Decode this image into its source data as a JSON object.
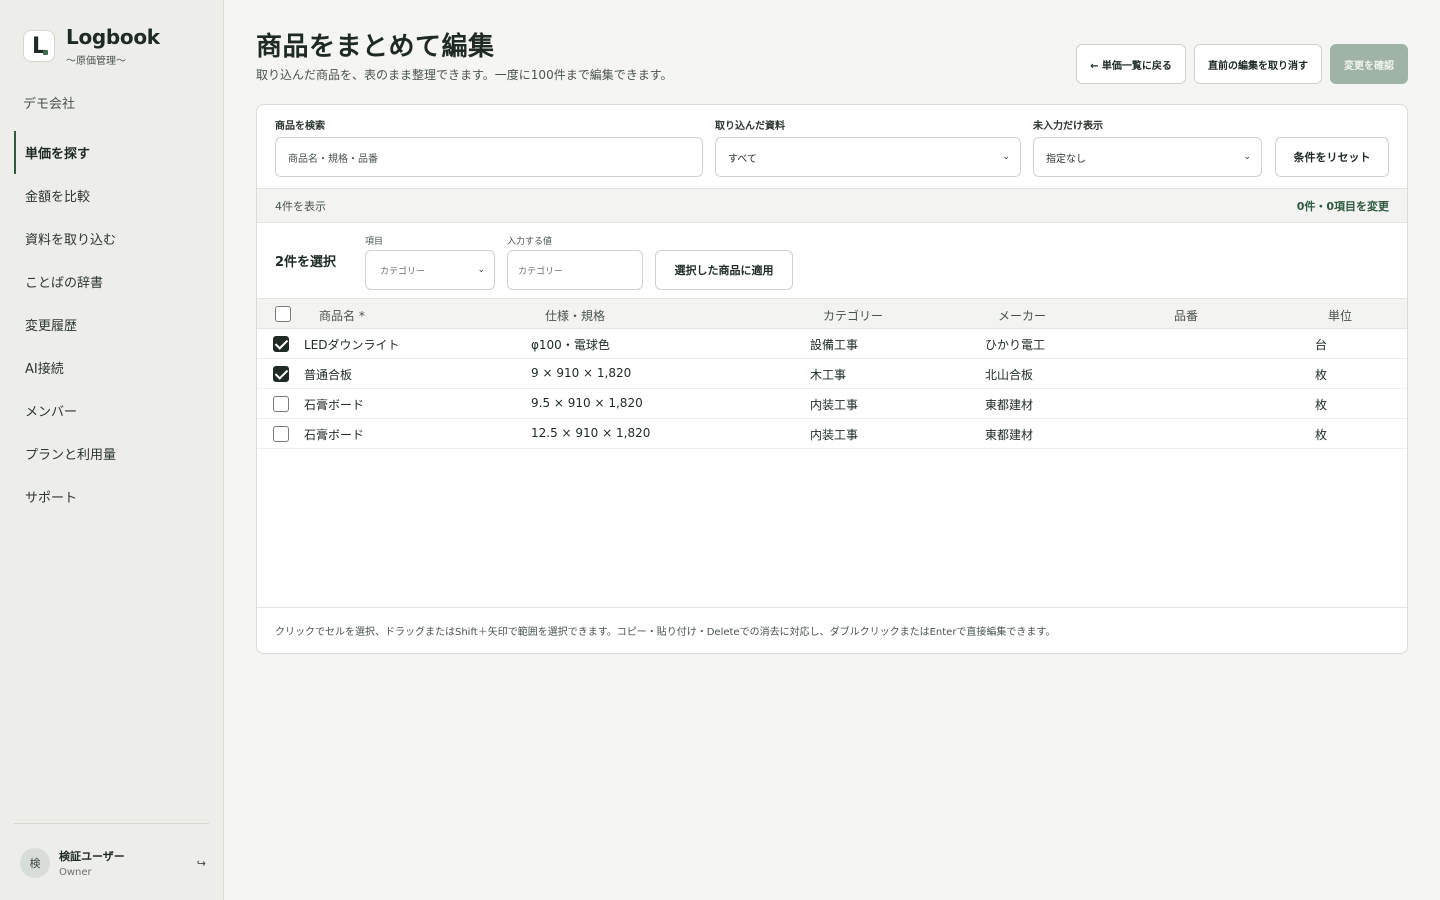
{
  "app": {
    "name": "Logbook",
    "subtitle": "〜原価管理〜",
    "logo_letter": "L",
    "company": "デモ会社"
  },
  "nav": [
    {
      "label": "単価を探す",
      "active": true
    },
    {
      "label": "金額を比較",
      "active": false
    },
    {
      "label": "資料を取り込む",
      "active": false
    },
    {
      "label": "ことばの辞書",
      "active": false
    },
    {
      "label": "変更履歴",
      "active": false
    },
    {
      "label": "AI接続",
      "active": false
    },
    {
      "label": "メンバー",
      "active": false
    },
    {
      "label": "プランと利用量",
      "active": false
    },
    {
      "label": "サポート",
      "active": false
    }
  ],
  "user": {
    "avatar": "検",
    "name": "検証ユーザー",
    "role": "Owner",
    "logout_glyph": "↪"
  },
  "header": {
    "title": "商品をまとめて編集",
    "description": "取り込んだ商品を、表のまま整理できます。一度に100件まで編集できます。",
    "back_button": "← 単価一覧に戻る",
    "undo_button": "直前の編集を取り消す",
    "confirm_button": "変更を確認"
  },
  "filters": {
    "search_label": "商品を検索",
    "search_placeholder": "商品名・規格・品番",
    "source_label": "取り込んだ資料",
    "source_value": "すべて",
    "empty_label": "未入力だけ表示",
    "empty_value": "指定なし",
    "reset_button": "条件をリセット"
  },
  "status": {
    "shown": "4件を表示",
    "changes": "0件・0項目を変更"
  },
  "bulk": {
    "selected": "2件を選択",
    "field_label": "項目",
    "field_value": "カテゴリー",
    "value_label": "入力する値",
    "value_placeholder": "カテゴリー",
    "apply_button": "選択した商品に適用"
  },
  "table": {
    "headers": {
      "name": "商品名 *",
      "spec": "仕様・規格",
      "category": "カテゴリー",
      "maker": "メーカー",
      "part_no": "品番",
      "unit": "単位"
    },
    "rows": [
      {
        "checked": true,
        "name": "LEDダウンライト",
        "spec": "φ100・電球色",
        "category": "設備工事",
        "maker": "ひかり電工",
        "part_no": "",
        "unit": "台"
      },
      {
        "checked": true,
        "name": "普通合板",
        "spec": "9 × 910 × 1,820",
        "category": "木工事",
        "maker": "北山合板",
        "part_no": "",
        "unit": "枚"
      },
      {
        "checked": false,
        "name": "石膏ボード",
        "spec": "9.5 × 910 × 1,820",
        "category": "内装工事",
        "maker": "東都建材",
        "part_no": "",
        "unit": "枚"
      },
      {
        "checked": false,
        "name": "石膏ボード",
        "spec": "12.5 × 910 × 1,820",
        "category": "内装工事",
        "maker": "東都建材",
        "part_no": "",
        "unit": "枚"
      }
    ]
  },
  "hint": "クリックでセルを選択、ドラッグまたはShift＋矢印で範囲を選択できます。コピー・貼り付け・Deleteでの消去に対応し、ダブルクリックまたはEnterで直接編集できます。",
  "colors": {
    "accent": "#2f5a3f",
    "confirm_disabled": "#9fb4a6",
    "sidebar_bg": "#ededea",
    "page_bg": "#f5f5f3"
  }
}
